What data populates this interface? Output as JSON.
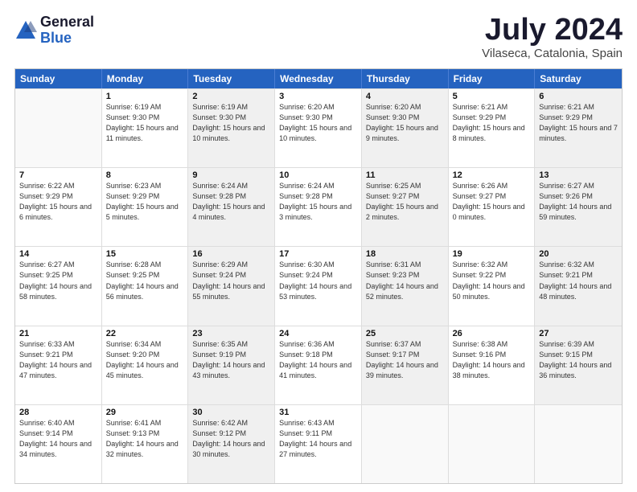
{
  "logo": {
    "general": "General",
    "blue": "Blue"
  },
  "header": {
    "month": "July 2024",
    "location": "Vilaseca, Catalonia, Spain"
  },
  "weekdays": [
    "Sunday",
    "Monday",
    "Tuesday",
    "Wednesday",
    "Thursday",
    "Friday",
    "Saturday"
  ],
  "rows": [
    [
      {
        "day": "",
        "sunrise": "",
        "sunset": "",
        "daylight": "",
        "shaded": false,
        "empty": true
      },
      {
        "day": "1",
        "sunrise": "Sunrise: 6:19 AM",
        "sunset": "Sunset: 9:30 PM",
        "daylight": "Daylight: 15 hours and 11 minutes.",
        "shaded": false,
        "empty": false
      },
      {
        "day": "2",
        "sunrise": "Sunrise: 6:19 AM",
        "sunset": "Sunset: 9:30 PM",
        "daylight": "Daylight: 15 hours and 10 minutes.",
        "shaded": true,
        "empty": false
      },
      {
        "day": "3",
        "sunrise": "Sunrise: 6:20 AM",
        "sunset": "Sunset: 9:30 PM",
        "daylight": "Daylight: 15 hours and 10 minutes.",
        "shaded": false,
        "empty": false
      },
      {
        "day": "4",
        "sunrise": "Sunrise: 6:20 AM",
        "sunset": "Sunset: 9:30 PM",
        "daylight": "Daylight: 15 hours and 9 minutes.",
        "shaded": true,
        "empty": false
      },
      {
        "day": "5",
        "sunrise": "Sunrise: 6:21 AM",
        "sunset": "Sunset: 9:29 PM",
        "daylight": "Daylight: 15 hours and 8 minutes.",
        "shaded": false,
        "empty": false
      },
      {
        "day": "6",
        "sunrise": "Sunrise: 6:21 AM",
        "sunset": "Sunset: 9:29 PM",
        "daylight": "Daylight: 15 hours and 7 minutes.",
        "shaded": true,
        "empty": false
      }
    ],
    [
      {
        "day": "7",
        "sunrise": "Sunrise: 6:22 AM",
        "sunset": "Sunset: 9:29 PM",
        "daylight": "Daylight: 15 hours and 6 minutes.",
        "shaded": false,
        "empty": false
      },
      {
        "day": "8",
        "sunrise": "Sunrise: 6:23 AM",
        "sunset": "Sunset: 9:29 PM",
        "daylight": "Daylight: 15 hours and 5 minutes.",
        "shaded": false,
        "empty": false
      },
      {
        "day": "9",
        "sunrise": "Sunrise: 6:24 AM",
        "sunset": "Sunset: 9:28 PM",
        "daylight": "Daylight: 15 hours and 4 minutes.",
        "shaded": true,
        "empty": false
      },
      {
        "day": "10",
        "sunrise": "Sunrise: 6:24 AM",
        "sunset": "Sunset: 9:28 PM",
        "daylight": "Daylight: 15 hours and 3 minutes.",
        "shaded": false,
        "empty": false
      },
      {
        "day": "11",
        "sunrise": "Sunrise: 6:25 AM",
        "sunset": "Sunset: 9:27 PM",
        "daylight": "Daylight: 15 hours and 2 minutes.",
        "shaded": true,
        "empty": false
      },
      {
        "day": "12",
        "sunrise": "Sunrise: 6:26 AM",
        "sunset": "Sunset: 9:27 PM",
        "daylight": "Daylight: 15 hours and 0 minutes.",
        "shaded": false,
        "empty": false
      },
      {
        "day": "13",
        "sunrise": "Sunrise: 6:27 AM",
        "sunset": "Sunset: 9:26 PM",
        "daylight": "Daylight: 14 hours and 59 minutes.",
        "shaded": true,
        "empty": false
      }
    ],
    [
      {
        "day": "14",
        "sunrise": "Sunrise: 6:27 AM",
        "sunset": "Sunset: 9:25 PM",
        "daylight": "Daylight: 14 hours and 58 minutes.",
        "shaded": false,
        "empty": false
      },
      {
        "day": "15",
        "sunrise": "Sunrise: 6:28 AM",
        "sunset": "Sunset: 9:25 PM",
        "daylight": "Daylight: 14 hours and 56 minutes.",
        "shaded": false,
        "empty": false
      },
      {
        "day": "16",
        "sunrise": "Sunrise: 6:29 AM",
        "sunset": "Sunset: 9:24 PM",
        "daylight": "Daylight: 14 hours and 55 minutes.",
        "shaded": true,
        "empty": false
      },
      {
        "day": "17",
        "sunrise": "Sunrise: 6:30 AM",
        "sunset": "Sunset: 9:24 PM",
        "daylight": "Daylight: 14 hours and 53 minutes.",
        "shaded": false,
        "empty": false
      },
      {
        "day": "18",
        "sunrise": "Sunrise: 6:31 AM",
        "sunset": "Sunset: 9:23 PM",
        "daylight": "Daylight: 14 hours and 52 minutes.",
        "shaded": true,
        "empty": false
      },
      {
        "day": "19",
        "sunrise": "Sunrise: 6:32 AM",
        "sunset": "Sunset: 9:22 PM",
        "daylight": "Daylight: 14 hours and 50 minutes.",
        "shaded": false,
        "empty": false
      },
      {
        "day": "20",
        "sunrise": "Sunrise: 6:32 AM",
        "sunset": "Sunset: 9:21 PM",
        "daylight": "Daylight: 14 hours and 48 minutes.",
        "shaded": true,
        "empty": false
      }
    ],
    [
      {
        "day": "21",
        "sunrise": "Sunrise: 6:33 AM",
        "sunset": "Sunset: 9:21 PM",
        "daylight": "Daylight: 14 hours and 47 minutes.",
        "shaded": false,
        "empty": false
      },
      {
        "day": "22",
        "sunrise": "Sunrise: 6:34 AM",
        "sunset": "Sunset: 9:20 PM",
        "daylight": "Daylight: 14 hours and 45 minutes.",
        "shaded": false,
        "empty": false
      },
      {
        "day": "23",
        "sunrise": "Sunrise: 6:35 AM",
        "sunset": "Sunset: 9:19 PM",
        "daylight": "Daylight: 14 hours and 43 minutes.",
        "shaded": true,
        "empty": false
      },
      {
        "day": "24",
        "sunrise": "Sunrise: 6:36 AM",
        "sunset": "Sunset: 9:18 PM",
        "daylight": "Daylight: 14 hours and 41 minutes.",
        "shaded": false,
        "empty": false
      },
      {
        "day": "25",
        "sunrise": "Sunrise: 6:37 AM",
        "sunset": "Sunset: 9:17 PM",
        "daylight": "Daylight: 14 hours and 39 minutes.",
        "shaded": true,
        "empty": false
      },
      {
        "day": "26",
        "sunrise": "Sunrise: 6:38 AM",
        "sunset": "Sunset: 9:16 PM",
        "daylight": "Daylight: 14 hours and 38 minutes.",
        "shaded": false,
        "empty": false
      },
      {
        "day": "27",
        "sunrise": "Sunrise: 6:39 AM",
        "sunset": "Sunset: 9:15 PM",
        "daylight": "Daylight: 14 hours and 36 minutes.",
        "shaded": true,
        "empty": false
      }
    ],
    [
      {
        "day": "28",
        "sunrise": "Sunrise: 6:40 AM",
        "sunset": "Sunset: 9:14 PM",
        "daylight": "Daylight: 14 hours and 34 minutes.",
        "shaded": false,
        "empty": false
      },
      {
        "day": "29",
        "sunrise": "Sunrise: 6:41 AM",
        "sunset": "Sunset: 9:13 PM",
        "daylight": "Daylight: 14 hours and 32 minutes.",
        "shaded": false,
        "empty": false
      },
      {
        "day": "30",
        "sunrise": "Sunrise: 6:42 AM",
        "sunset": "Sunset: 9:12 PM",
        "daylight": "Daylight: 14 hours and 30 minutes.",
        "shaded": true,
        "empty": false
      },
      {
        "day": "31",
        "sunrise": "Sunrise: 6:43 AM",
        "sunset": "Sunset: 9:11 PM",
        "daylight": "Daylight: 14 hours and 27 minutes.",
        "shaded": false,
        "empty": false
      },
      {
        "day": "",
        "sunrise": "",
        "sunset": "",
        "daylight": "",
        "shaded": true,
        "empty": true
      },
      {
        "day": "",
        "sunrise": "",
        "sunset": "",
        "daylight": "",
        "shaded": false,
        "empty": true
      },
      {
        "day": "",
        "sunrise": "",
        "sunset": "",
        "daylight": "",
        "shaded": true,
        "empty": true
      }
    ]
  ]
}
